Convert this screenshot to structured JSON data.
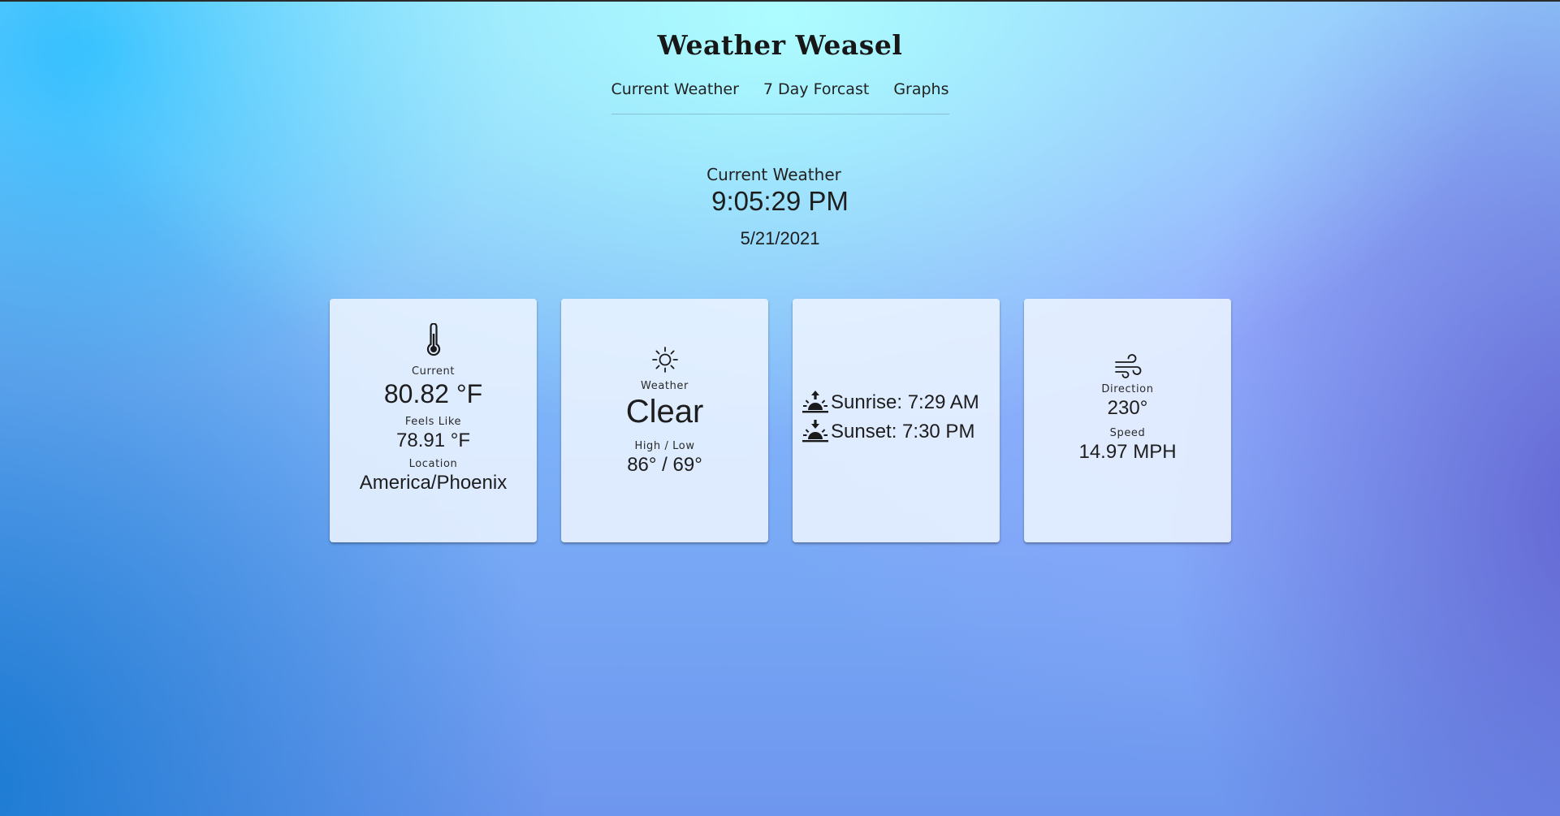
{
  "app": {
    "title": "Weather Weasel"
  },
  "nav": {
    "items": [
      {
        "label": "Current Weather"
      },
      {
        "label": "7 Day Forcast"
      },
      {
        "label": "Graphs"
      }
    ]
  },
  "current": {
    "section_title": "Current Weather",
    "time": "9:05:29 PM",
    "date": "5/21/2021"
  },
  "cards": {
    "temperature": {
      "icon": "thermometer-icon",
      "current_label": "Current",
      "current_value": "80.82 °F",
      "feels_like_label": "Feels Like",
      "feels_like_value": "78.91 °F",
      "location_label": "Location",
      "location_value": "America/Phoenix"
    },
    "conditions": {
      "icon": "sun-icon",
      "weather_label": "Weather",
      "weather_value": "Clear",
      "high_low_label": "High / Low",
      "high_low_value": "86° / 69°"
    },
    "sun": {
      "sunrise_icon": "sunrise-icon",
      "sunrise_text": "Sunrise: 7:29 AM",
      "sunset_icon": "sunset-icon",
      "sunset_text": "Sunset: 7:30 PM"
    },
    "wind": {
      "icon": "wind-icon",
      "direction_label": "Direction",
      "direction_value": "230°",
      "speed_label": "Speed",
      "speed_value": "14.97 MPH"
    }
  }
}
